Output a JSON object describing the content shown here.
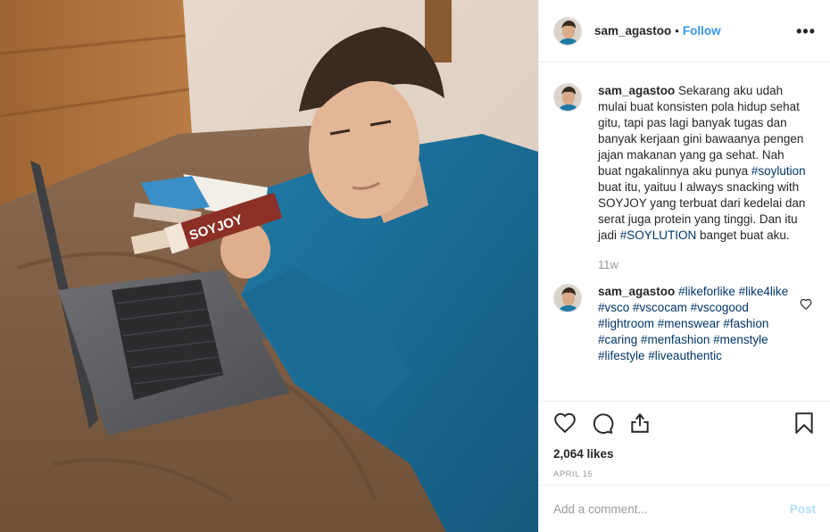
{
  "post": {
    "username": "sam_agastoo",
    "follow_label": "Follow",
    "separator": "•",
    "more_label": "•••"
  },
  "caption": {
    "username": "sam_agastoo",
    "text_1": " Sekarang aku udah mulai buat konsisten pola hidup sehat gitu, tapi pas lagi banyak tugas dan banyak kerjaan gini bawaanya pengen jajan makanan yang ga sehat. Nah buat ngakalinnya aku punya ",
    "tag_1": "#soylution",
    "text_2": " buat itu, yaituu I always snacking with SOYJOY yang terbuat dari kedelai dan serat juga protein yang tinggi. Dan itu jadi ",
    "tag_2": "#SOYLUTION",
    "text_3": " banget buat aku.",
    "time": "11w"
  },
  "comment": {
    "username": "sam_agastoo",
    "tags": [
      "#likeforlike",
      "#like4like",
      "#vsco",
      "#vscocam",
      "#vscogood",
      "#lightroom",
      "#menswear",
      "#fashion",
      "#caring",
      "#menfashion",
      "#menstyle",
      "#lifestyle",
      "#liveauthentic"
    ]
  },
  "actions": {
    "likes": "2,064 likes",
    "date": "APRIL 15"
  },
  "add_comment": {
    "placeholder": "Add a comment...",
    "post_label": "Post"
  },
  "photo": {
    "bar_label": "SOYJOY"
  },
  "icons": {
    "like": "heart-icon",
    "comment": "comment-icon",
    "share": "share-icon",
    "save": "bookmark-icon",
    "comment_like": "small-heart-icon"
  },
  "colors": {
    "link": "#3897f0",
    "hashtag": "#003569",
    "post_disabled": "#b2dffc"
  }
}
